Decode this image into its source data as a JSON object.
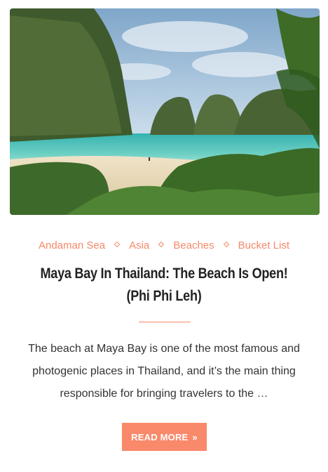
{
  "post": {
    "image_alt": "Maya Bay beach with turquoise water and limestone cliffs",
    "categories": [
      "Andaman Sea",
      "Asia",
      "Beaches",
      "Bucket List"
    ],
    "title": "Maya Bay In Thailand: The Beach Is Open! (Phi Phi Leh)",
    "excerpt": "The beach at Maya Bay is one of the most famous and photogenic places in Thailand, and it’s the main thing responsible for bringing travelers to the …",
    "read_more_label": "READ MORE",
    "read_more_icon": "double-chevron-right-icon"
  },
  "colors": {
    "accent": "#f5896a",
    "button_bg": "#f9896b",
    "title": "#222222",
    "text": "#333333"
  }
}
